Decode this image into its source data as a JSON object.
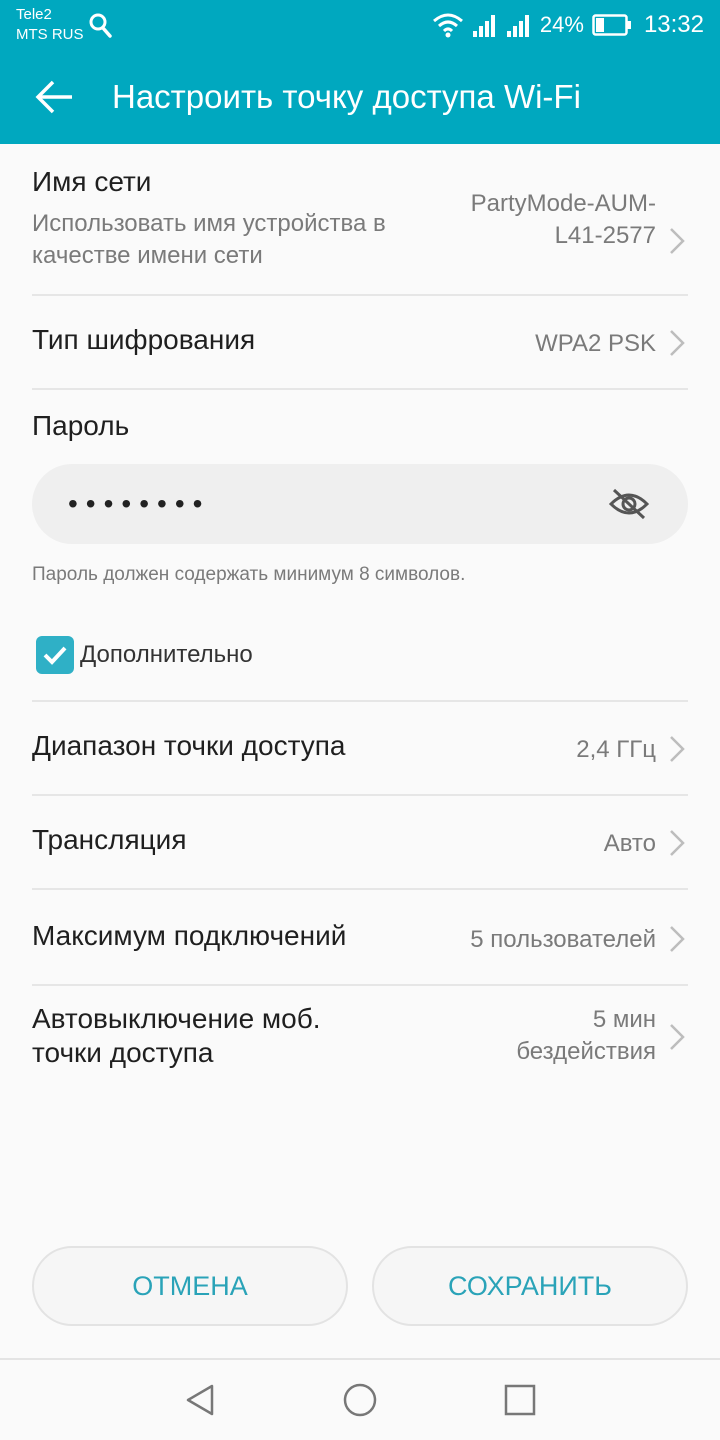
{
  "status_bar": {
    "carrier_1": "Tele2",
    "carrier_2": "MTS RUS",
    "battery_percent": "24%",
    "time": "13:32"
  },
  "app_bar": {
    "title": "Настроить точку доступа Wi-Fi"
  },
  "network_name": {
    "title": "Имя сети",
    "subtitle": "Использовать имя устройства в качестве имени сети",
    "value_line1": "PartyMode-AUM-",
    "value_line2": "L41-2577"
  },
  "encryption": {
    "title": "Тип шифрования",
    "value": "WPA2 PSK"
  },
  "password": {
    "title": "Пароль",
    "masked_value": "••••••••",
    "hint": "Пароль должен содержать минимум 8 символов."
  },
  "advanced": {
    "label": "Дополнительно",
    "checked": true
  },
  "band": {
    "title": "Диапазон точки доступа",
    "value": "2,4 ГГц"
  },
  "broadcast": {
    "title": "Трансляция",
    "value": "Авто"
  },
  "max_connections": {
    "title": "Максимум подключений",
    "value": "5 пользователей"
  },
  "auto_off": {
    "title_line1": "Автовыключение моб.",
    "title_line2": "точки доступа",
    "value_line1": "5 мин",
    "value_line2": "бездействия"
  },
  "buttons": {
    "cancel": "ОТМЕНА",
    "save": "СОХРАНИТЬ"
  },
  "colors": {
    "accent": "#00a8bf",
    "button_text": "#2aa3b8",
    "checkbox": "#2fb0c6"
  }
}
